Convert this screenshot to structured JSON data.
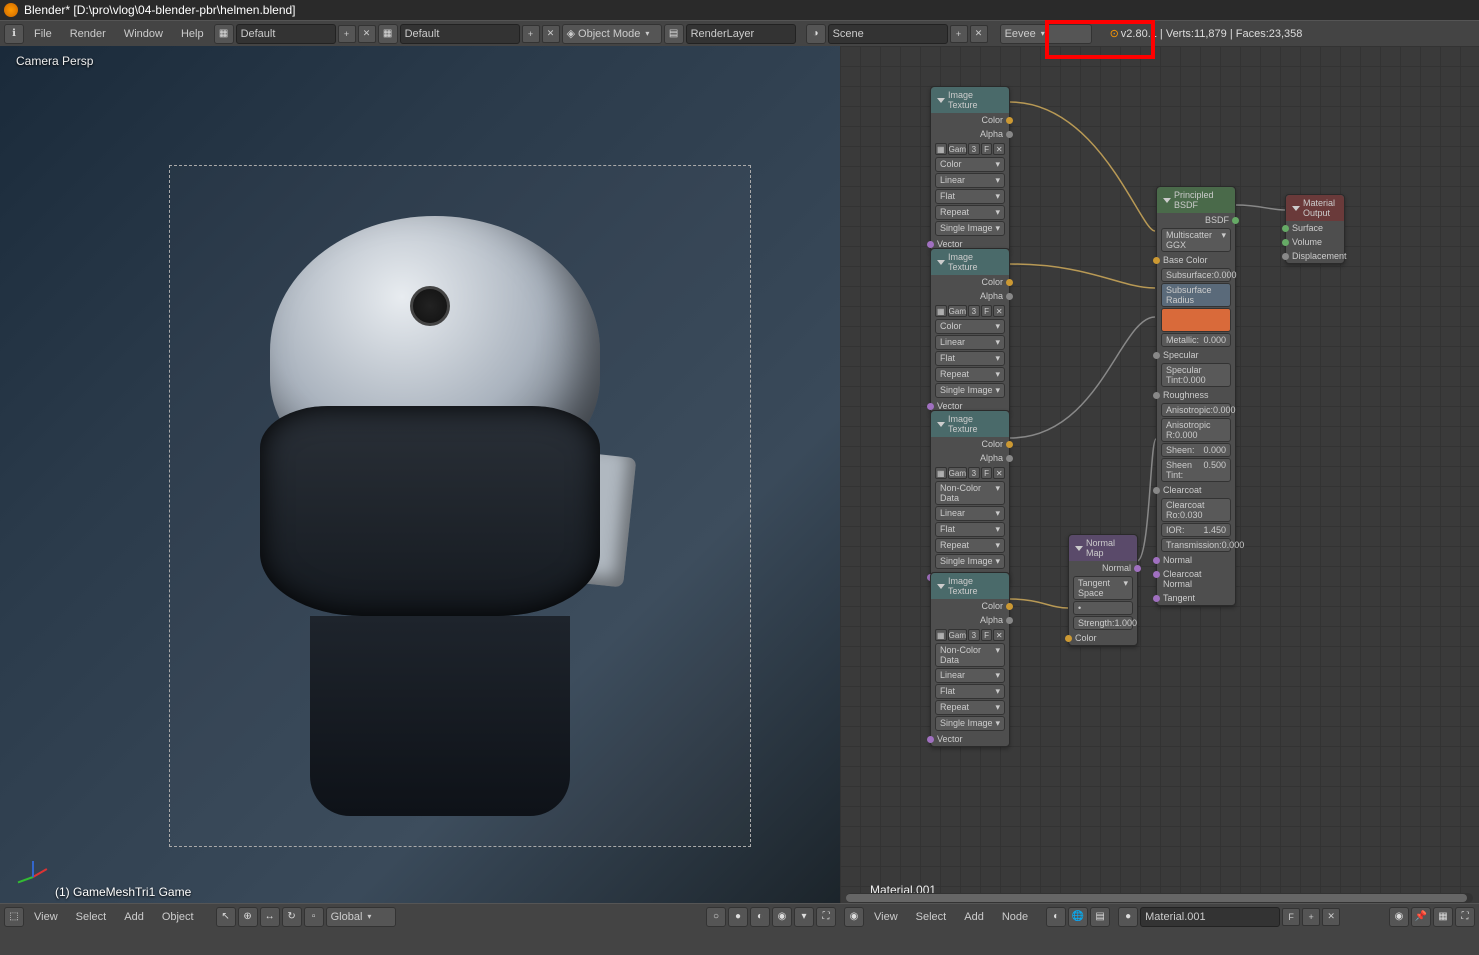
{
  "titlebar": {
    "text": "Blender* [D:\\pro\\vlog\\04-blender-pbr\\helmen.blend]"
  },
  "topmenu": {
    "file": "File",
    "render": "Render",
    "window": "Window",
    "help": "Help"
  },
  "header": {
    "layout_value": "Default",
    "scene_layout_value": "Default",
    "object_mode": "Object Mode",
    "render_layer": "RenderLayer",
    "scene": "Scene",
    "engine": "Eevee",
    "stats": "v2.80.1 | Verts:11,879 | Faces:23,358"
  },
  "viewport": {
    "perspective": "Camera Persp",
    "active_object": "(1) GameMeshTri1 Game",
    "footer": {
      "view": "View",
      "select": "Select",
      "add": "Add",
      "object": "Object",
      "orientation": "Global"
    }
  },
  "nodes": {
    "img_tex_title": "Image Texture",
    "img_out_color": "Color",
    "img_out_alpha": "Alpha",
    "img_vector": "Vector",
    "img_btn_gam": "Gam",
    "img_btn_3": "3",
    "img_btn_f": "F",
    "img_color_space_color": "Color",
    "img_color_space_noncolor": "Non-Color Data",
    "img_interp": "Linear",
    "img_proj": "Flat",
    "img_ext": "Repeat",
    "img_source": "Single Image",
    "principled_title": "Principled BSDF",
    "p_bsdf": "BSDF",
    "p_dist": "Multiscatter GGX",
    "p_basecolor": "Base Color",
    "p_subsurf": "Subsurface:",
    "p_subsurf_v": "0.000",
    "p_subsurf_radius": "Subsurface Radius",
    "p_subsurf_color": "Subsurface Color",
    "p_metallic": "Metallic:",
    "p_metallic_v": "0.000",
    "p_specular": "Specular",
    "p_spectint": "Specular Tint:0.000",
    "p_rough": "Roughness",
    "p_aniso": "Anisotropic:",
    "p_aniso_v": "0.000",
    "p_anisorot": "Anisotropic R:0.000",
    "p_sheen": "Sheen:",
    "p_sheen_v": "0.000",
    "p_sheentint": "Sheen Tint:",
    "p_sheentint_v": "0.500",
    "p_clearcoat": "Clearcoat",
    "p_clearcoatr": "Clearcoat Ro:0.030",
    "p_ior": "IOR:",
    "p_ior_v": "1.450",
    "p_trans": "Transmission:0.000",
    "p_normal": "Normal",
    "p_cc_normal": "Clearcoat Normal",
    "p_tangent": "Tangent",
    "output_title": "Material Output",
    "out_surface": "Surface",
    "out_volume": "Volume",
    "out_disp": "Displacement",
    "normalmap_title": "Normal Map",
    "nm_normal": "Normal",
    "nm_space": "Tangent Space",
    "nm_strength": "Strength:",
    "nm_strength_v": "1.000",
    "nm_color": "Color",
    "material_name": "Material.001"
  },
  "ne_footer": {
    "view": "View",
    "select": "Select",
    "add": "Add",
    "node": "Node",
    "material": "Material.001",
    "f": "F"
  }
}
